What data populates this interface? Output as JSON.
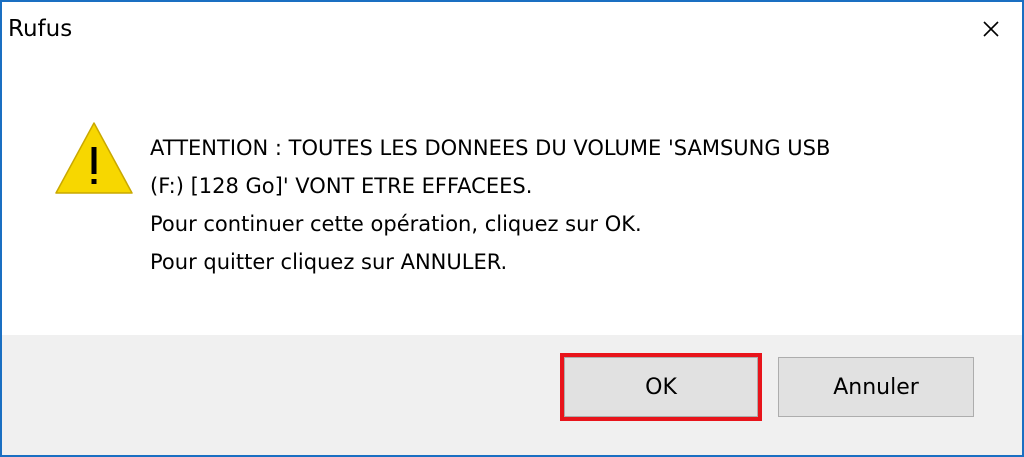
{
  "window": {
    "title": "Rufus",
    "accent_color": "#1a6fc2",
    "close_icon": "close-icon"
  },
  "dialog": {
    "icon": "warning-icon",
    "icon_color": "#f7d700",
    "message_lines": [
      "ATTENTION : TOUTES LES DONNEES DU VOLUME 'SAMSUNG USB",
      "(F:) [128 Go]' VONT ETRE EFFACEES.",
      "Pour continuer cette opération, cliquez sur OK.",
      "Pour quitter cliquez sur ANNULER."
    ]
  },
  "buttons": {
    "ok_label": "OK",
    "cancel_label": "Annuler",
    "highlight_color": "#e8141b"
  }
}
